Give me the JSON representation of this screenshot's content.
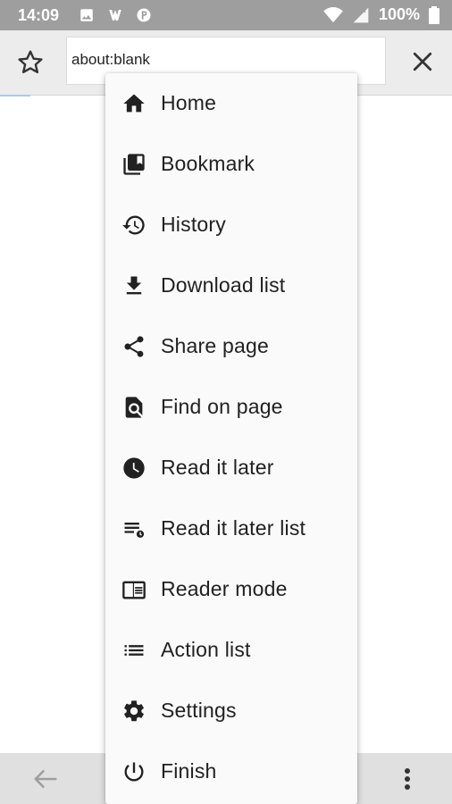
{
  "status_bar": {
    "time": "14:09",
    "battery": "100%"
  },
  "toolbar": {
    "url": "about:blank"
  },
  "menu": {
    "items": [
      {
        "label": "Home",
        "icon": "home-icon"
      },
      {
        "label": "Bookmark",
        "icon": "bookmark-icon"
      },
      {
        "label": "History",
        "icon": "history-icon"
      },
      {
        "label": "Download list",
        "icon": "download-icon"
      },
      {
        "label": "Share page",
        "icon": "share-icon"
      },
      {
        "label": "Find on page",
        "icon": "find-in-page-icon"
      },
      {
        "label": "Read it later",
        "icon": "clock-icon"
      },
      {
        "label": "Read it later list",
        "icon": "read-later-list-icon"
      },
      {
        "label": "Reader mode",
        "icon": "reader-mode-icon"
      },
      {
        "label": "Action list",
        "icon": "list-icon"
      },
      {
        "label": "Settings",
        "icon": "gear-icon"
      },
      {
        "label": "Finish",
        "icon": "power-icon"
      }
    ]
  },
  "colors": {
    "status_bar": "#9e9e9e",
    "toolbar": "#ececec",
    "menu_background": "#fafafa",
    "text": "#212121"
  }
}
